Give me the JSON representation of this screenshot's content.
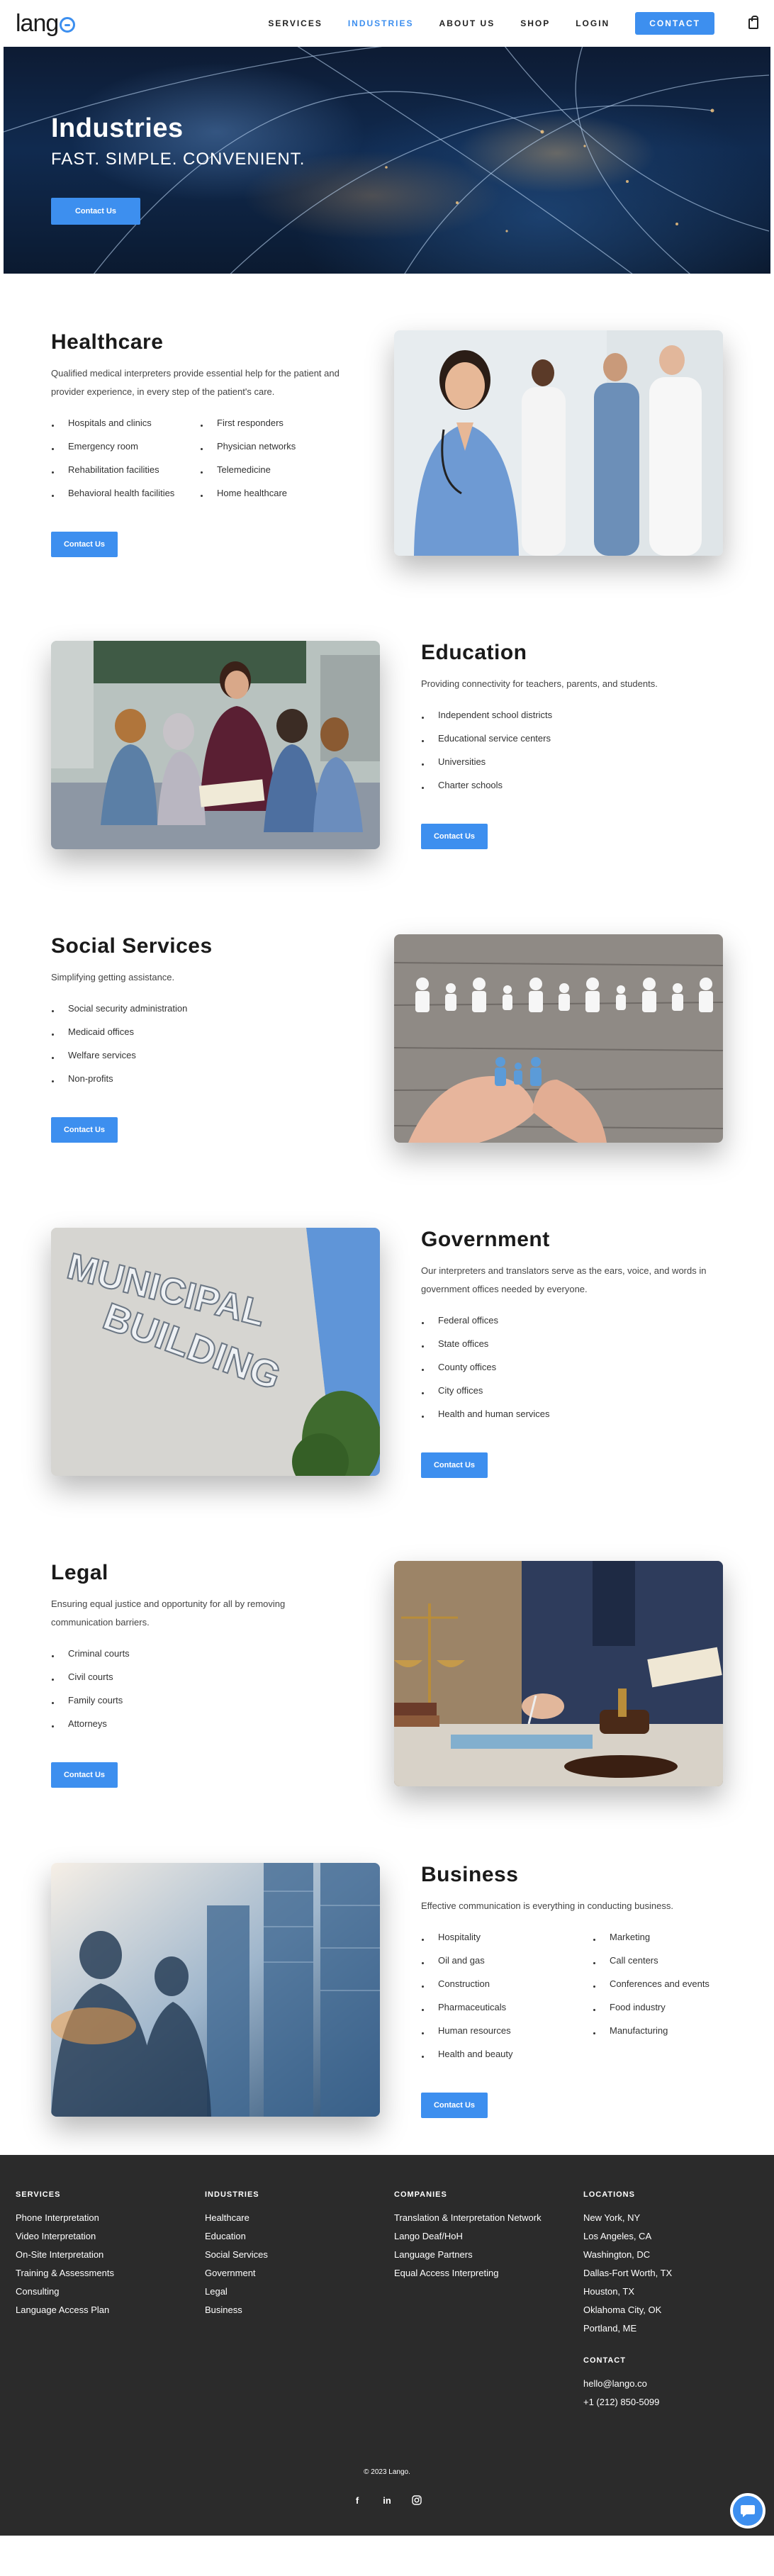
{
  "nav": {
    "logo": "lang",
    "items": [
      {
        "label": "SERVICES",
        "active": false
      },
      {
        "label": "INDUSTRIES",
        "active": true
      },
      {
        "label": "ABOUT US",
        "active": false
      },
      {
        "label": "SHOP",
        "active": false
      },
      {
        "label": "LOGIN",
        "active": false
      }
    ],
    "contact_label": "CONTACT"
  },
  "hero": {
    "title": "Industries",
    "subtitle": "FAST. SIMPLE. CONVENIENT.",
    "button": "Contact Us"
  },
  "sections": [
    {
      "title": "Healthcare",
      "desc": "Qualified medical interpreters provide essential help for the patient and provider experience, in every step of the patient's care.",
      "list_left": [
        "Hospitals and clinics",
        "Emergency room",
        "Rehabilitation facilities",
        "Behavioral health facilities"
      ],
      "list_right": [
        "First responders",
        "Physician networks",
        "Telemedicine",
        "Home healthcare"
      ],
      "button": "Contact Us",
      "image": "medical-staff-photo"
    },
    {
      "title": "Education",
      "desc": "Providing connectivity for teachers, parents, and students.",
      "list_left": [
        "Independent school districts",
        "Educational service centers",
        "Universities",
        "Charter schools"
      ],
      "list_right": [],
      "button": "Contact Us",
      "image": "classroom-reading-photo"
    },
    {
      "title": "Social Services",
      "desc": "Simplifying getting assistance.",
      "list_left": [
        "Social security administration",
        "Medicaid offices",
        "Welfare services",
        "Non-profits"
      ],
      "list_right": [],
      "button": "Contact Us",
      "image": "paper-family-hands-photo"
    },
    {
      "title": "Government",
      "desc": "Our interpreters and translators serve as the ears, voice, and words in government offices needed by everyone.",
      "list_left": [
        "Federal offices",
        "State offices",
        "County offices",
        "City offices",
        "Health and human services"
      ],
      "list_right": [],
      "button": "Contact Us",
      "image": "municipal-building-photo",
      "sign_line1": "MUNICIPAL",
      "sign_line2": "BUILDING"
    },
    {
      "title": "Legal",
      "desc": "Ensuring equal justice and opportunity for all by removing communication barriers.",
      "list_left": [
        "Criminal courts",
        "Civil courts",
        "Family courts",
        "Attorneys"
      ],
      "list_right": [],
      "button": "Contact Us",
      "image": "gavel-scales-photo"
    },
    {
      "title": "Business",
      "desc": "Effective communication is everything in conducting business.",
      "list_left": [
        "Hospitality",
        "Oil and gas",
        "Construction",
        "Pharmaceuticals",
        "Human resources",
        "Health and beauty"
      ],
      "list_right": [
        "Marketing",
        "Call centers",
        "Conferences and events",
        "Food industry",
        "Manufacturing"
      ],
      "button": "Contact Us",
      "image": "business-skyline-photo"
    }
  ],
  "footer": {
    "services": {
      "heading": "SERVICES",
      "items": [
        "Phone Interpretation",
        "Video Interpretation",
        "On-Site Interpretation",
        "Training & Assessments",
        "Consulting",
        "Language Access Plan"
      ]
    },
    "industries": {
      "heading": "INDUSTRIES",
      "items": [
        "Healthcare",
        "Education",
        "Social Services",
        "Government",
        "Legal",
        "Business"
      ]
    },
    "companies": {
      "heading": "COMPANIES",
      "items": [
        "Translation & Interpretation Network",
        "Lango Deaf/HoH",
        "Language Partners",
        "Equal Access Interpreting"
      ]
    },
    "locations": {
      "heading": "LOCATIONS",
      "items": [
        "New York, NY",
        "Los Angeles, CA",
        "Washington, DC",
        "Dallas-Fort Worth, TX",
        "Houston, TX",
        "Oklahoma City, OK",
        "Portland, ME"
      ]
    },
    "contact": {
      "heading": "CONTACT",
      "email": "hello@lango.co",
      "phone": "+1 (212) 850-5099"
    },
    "copyright": "© 2023 Lango.",
    "socials": [
      "f",
      "in",
      "instagram-icon"
    ]
  },
  "colors": {
    "accent": "#3d8fef",
    "footer_bg": "#2b2b2b",
    "text_dark": "#1a1a1a"
  }
}
